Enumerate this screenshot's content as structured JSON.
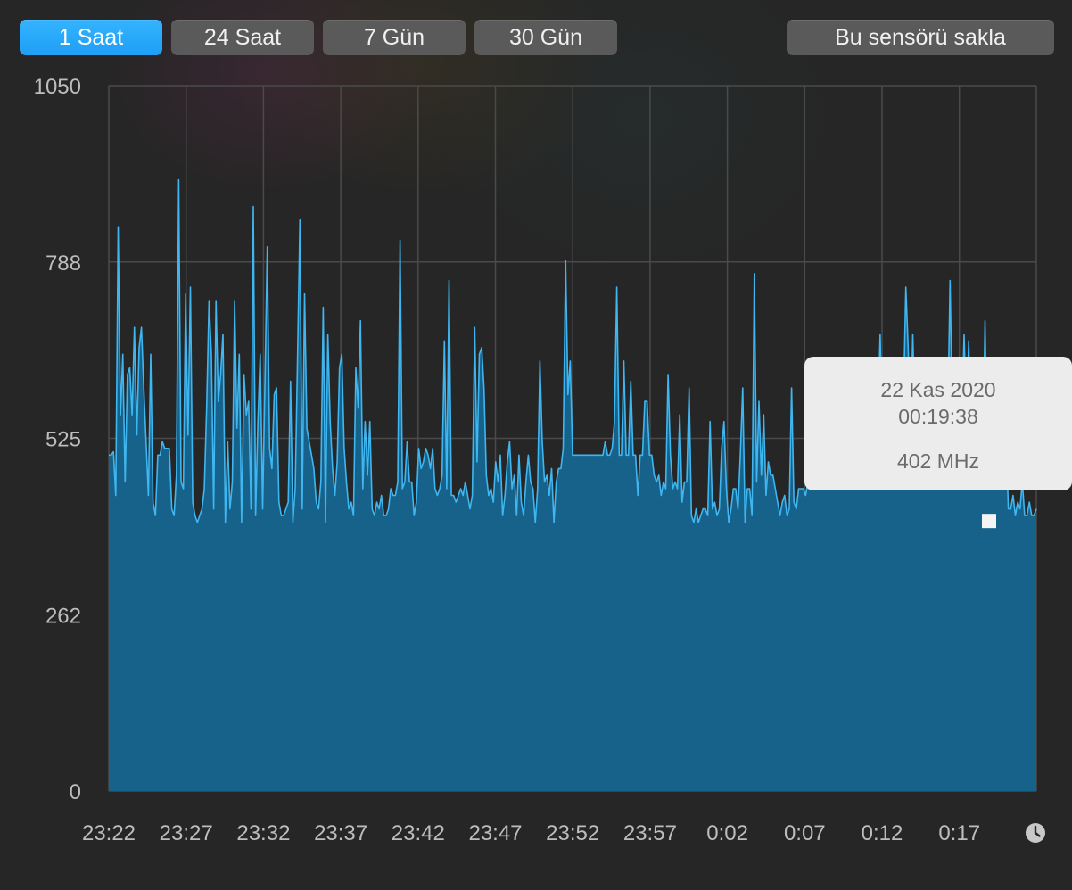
{
  "toolbar": {
    "tabs": [
      {
        "label": "1 Saat",
        "active": true
      },
      {
        "label": "24 Saat",
        "active": false
      },
      {
        "label": "7 Gün",
        "active": false
      },
      {
        "label": "30 Gün",
        "active": false
      }
    ],
    "hide_sensor_label": "Bu sensörü sakla"
  },
  "tooltip": {
    "date": "22 Kas 2020",
    "time": "00:19:38",
    "value": "402 MHz"
  },
  "colors": {
    "line": "#3fb6f0",
    "fill": "#16628a",
    "accent": "#2aa8fb"
  },
  "chart_data": {
    "type": "area",
    "yticks": [
      "1050",
      "788",
      "525",
      "262",
      "0"
    ],
    "ylim": [
      0,
      1050
    ],
    "xticks": [
      "23:22",
      "23:27",
      "23:32",
      "23:37",
      "23:42",
      "23:47",
      "23:52",
      "23:57",
      "0:02",
      "0:07",
      "0:12",
      "0:17"
    ],
    "grid": true,
    "highlight": {
      "time": "00:19:38",
      "value": 402
    },
    "values": [
      500,
      500,
      505,
      440,
      840,
      560,
      650,
      460,
      620,
      630,
      560,
      690,
      530,
      660,
      690,
      600,
      520,
      440,
      650,
      430,
      410,
      500,
      500,
      520,
      510,
      510,
      510,
      420,
      410,
      470,
      910,
      460,
      450,
      740,
      530,
      750,
      430,
      410,
      400,
      410,
      420,
      450,
      570,
      730,
      650,
      420,
      730,
      580,
      620,
      680,
      400,
      520,
      420,
      460,
      730,
      540,
      650,
      400,
      620,
      560,
      580,
      420,
      870,
      410,
      550,
      650,
      420,
      610,
      810,
      510,
      480,
      590,
      600,
      430,
      410,
      410,
      420,
      430,
      610,
      400,
      450,
      650,
      850,
      420,
      740,
      540,
      520,
      500,
      480,
      430,
      420,
      460,
      720,
      400,
      680,
      550,
      480,
      440,
      490,
      630,
      650,
      510,
      460,
      420,
      430,
      410,
      630,
      570,
      700,
      450,
      550,
      470,
      550,
      420,
      410,
      430,
      420,
      440,
      410,
      410,
      420,
      450,
      440,
      440,
      460,
      820,
      450,
      460,
      520,
      460,
      460,
      410,
      430,
      510,
      480,
      490,
      510,
      500,
      480,
      510,
      450,
      440,
      450,
      470,
      670,
      450,
      760,
      440,
      440,
      430,
      440,
      450,
      440,
      460,
      440,
      420,
      440,
      690,
      490,
      650,
      660,
      600,
      470,
      440,
      450,
      430,
      490,
      460,
      500,
      410,
      440,
      490,
      520,
      450,
      470,
      410,
      500,
      430,
      410,
      460,
      500,
      460,
      450,
      400,
      450,
      640,
      520,
      460,
      470,
      440,
      480,
      400,
      460,
      480,
      480,
      510,
      790,
      590,
      640,
      500,
      500,
      500,
      500,
      500,
      500,
      500,
      500,
      500,
      500,
      500,
      500,
      500,
      500,
      520,
      500,
      500,
      510,
      550,
      750,
      500,
      500,
      640,
      500,
      500,
      610,
      500,
      500,
      440,
      500,
      500,
      580,
      580,
      500,
      500,
      470,
      460,
      470,
      440,
      460,
      450,
      620,
      500,
      450,
      460,
      450,
      560,
      430,
      460,
      460,
      600,
      410,
      400,
      420,
      400,
      410,
      420,
      420,
      410,
      550,
      420,
      430,
      410,
      420,
      510,
      550,
      450,
      400,
      420,
      450,
      450,
      420,
      500,
      600,
      400,
      450,
      450,
      410,
      770,
      460,
      580,
      470,
      560,
      440,
      490,
      470,
      470,
      450,
      430,
      410,
      430,
      440,
      410,
      420,
      600,
      430,
      420,
      450,
      450,
      450,
      440,
      460,
      500,
      550,
      500,
      540,
      630,
      500,
      520,
      500,
      510,
      520,
      550,
      510,
      560,
      560,
      530,
      520,
      520,
      570,
      520,
      520,
      520,
      500,
      530,
      520,
      500,
      500,
      550,
      520,
      520,
      550,
      680,
      510,
      500,
      560,
      590,
      550,
      530,
      580,
      540,
      560,
      580,
      750,
      660,
      520,
      680,
      540,
      530,
      560,
      520,
      550,
      520,
      530,
      540,
      580,
      580,
      560,
      530,
      560,
      520,
      550,
      760,
      550,
      510,
      520,
      500,
      540,
      680,
      550,
      670,
      470,
      510,
      490,
      480,
      530,
      470,
      700,
      470,
      490,
      460,
      550,
      550,
      510,
      530,
      480,
      530,
      420,
      420,
      440,
      410,
      430,
      420,
      460,
      410,
      410,
      430,
      410,
      410,
      420
    ]
  }
}
